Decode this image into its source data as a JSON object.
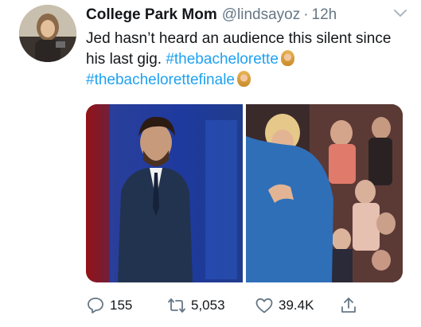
{
  "tweet": {
    "display_name": "College Park Mom",
    "handle": "@lindsayoz",
    "separator": "·",
    "time": "12h",
    "text_plain": "Jed hasn’t heard an audience this silent since his last gig. ",
    "hashtag_1": "#thebachelorette",
    "hashtag_2": "#thebachelorettefinale",
    "accent_color": "#1da1f2"
  },
  "icons": {
    "menu": "chevron-down-icon",
    "reply": "reply-icon",
    "retweet": "retweet-icon",
    "like": "heart-icon",
    "share": "share-icon",
    "emoji": "bride-emoji-icon"
  },
  "actions": {
    "replies": "155",
    "retweets": "5,053",
    "likes": "39.4K"
  }
}
